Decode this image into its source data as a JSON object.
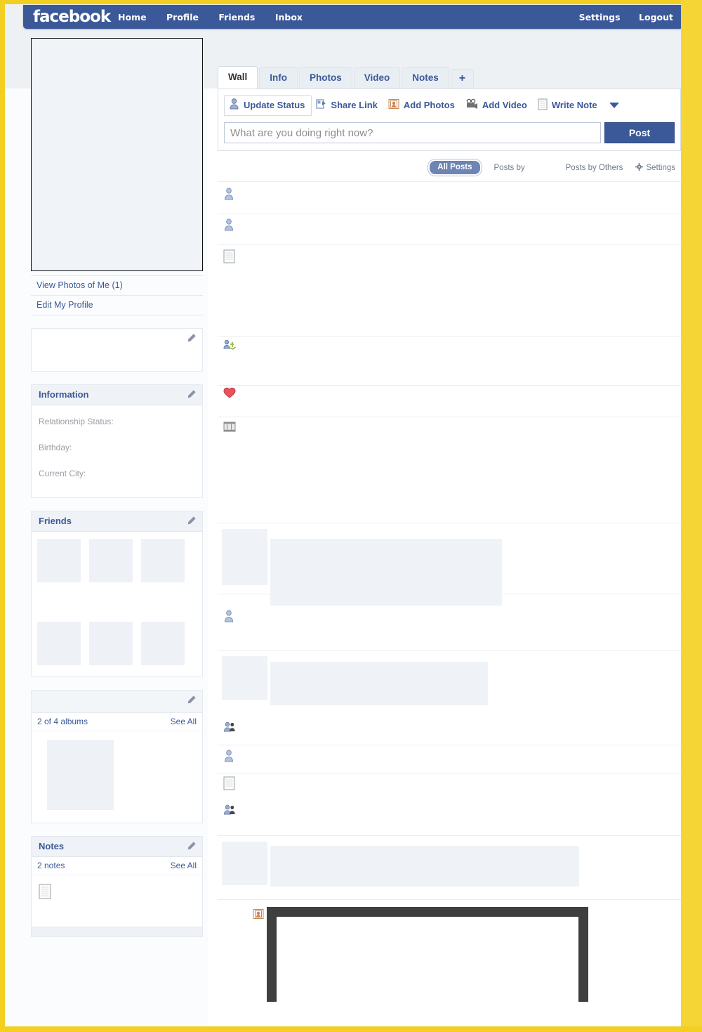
{
  "brand": {
    "logo": "facebook",
    "color": "#3b5998"
  },
  "nav": {
    "links": [
      {
        "label": "Home",
        "name": "nav-home"
      },
      {
        "label": "Profile",
        "name": "nav-profile"
      },
      {
        "label": "Friends",
        "name": "nav-friends"
      },
      {
        "label": "Inbox",
        "name": "nav-inbox"
      }
    ],
    "right": [
      {
        "label": "Settings",
        "name": "nav-settings"
      },
      {
        "label": "Logout",
        "name": "nav-logout"
      }
    ]
  },
  "sidebar": {
    "profile_links": [
      {
        "label": "View Photos of Me (1)"
      },
      {
        "label": "Edit My Profile"
      }
    ],
    "information": {
      "title": "Information",
      "fields": [
        {
          "label": "Relationship Status:",
          "value": ""
        },
        {
          "label": "Birthday:",
          "value": ""
        },
        {
          "label": "Current City:",
          "value": ""
        }
      ]
    },
    "friends": {
      "title": "Friends"
    },
    "photos": {
      "title": "",
      "count_label": "2 of 4 albums",
      "see_all": "See All"
    },
    "notes": {
      "title": "Notes",
      "count_label": "2 notes",
      "see_all": "See All"
    }
  },
  "main": {
    "tabs": [
      {
        "label": "Wall",
        "active": true
      },
      {
        "label": "Info",
        "active": false
      },
      {
        "label": "Photos",
        "active": false
      },
      {
        "label": "Video",
        "active": false
      },
      {
        "label": "Notes",
        "active": false
      }
    ],
    "add_tab_label": "+",
    "publisher": {
      "tools": [
        {
          "label": "Update Status",
          "icon": "person-icon",
          "active": true
        },
        {
          "label": "Share Link",
          "icon": "link-icon",
          "active": false
        },
        {
          "label": "Add Photos",
          "icon": "photo-icon",
          "active": false
        },
        {
          "label": "Add Video",
          "icon": "video-camera-icon",
          "active": false
        },
        {
          "label": "Write Note",
          "icon": "note-icon",
          "active": false
        }
      ],
      "placeholder": "What are you doing right now?",
      "post_label": "Post"
    },
    "filters": {
      "all_posts": "All Posts",
      "posts_by": "Posts by",
      "posts_by_others": "Posts by Others",
      "settings": "Settings"
    },
    "stories": [
      {
        "icon": "person-icon",
        "text": ""
      },
      {
        "icon": "person-icon",
        "text": ""
      },
      {
        "icon": "note-icon",
        "text": ""
      },
      {
        "icon": "friend-add-icon",
        "text": ""
      },
      {
        "icon": "heart-icon",
        "text": ""
      },
      {
        "icon": "film-icon",
        "text": ""
      },
      {
        "icon": "person-icon",
        "text": ""
      },
      {
        "icon": "friends-pair-icon",
        "text": ""
      },
      {
        "icon": "person-icon",
        "text": ""
      },
      {
        "icon": "note-icon",
        "text": ""
      },
      {
        "icon": "friends-pair-icon",
        "text": ""
      },
      {
        "icon": "photo-icon",
        "text": ""
      }
    ]
  }
}
